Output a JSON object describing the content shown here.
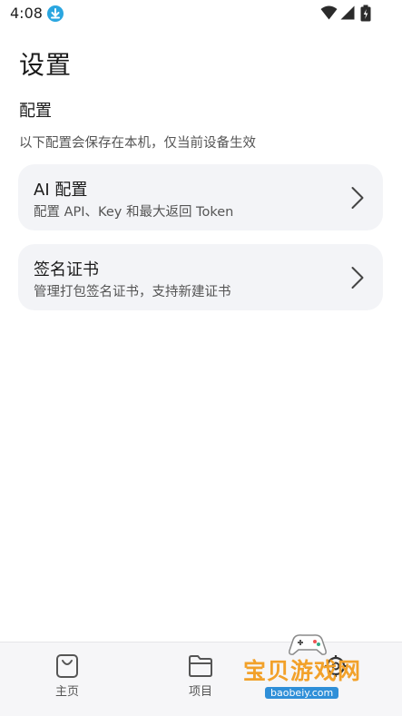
{
  "status_bar": {
    "time": "4:08"
  },
  "header": {
    "title": "设置"
  },
  "section": {
    "title": "配置",
    "description": "以下配置会保存在本机，仅当前设备生效"
  },
  "cards": [
    {
      "title": "AI 配置",
      "subtitle": "配置 API、Key 和最大返回 Token"
    },
    {
      "title": "签名证书",
      "subtitle": "管理打包签名证书，支持新建证书"
    }
  ],
  "bottom_nav": {
    "items": [
      {
        "label": "主页",
        "icon": "bag-icon"
      },
      {
        "label": "项目",
        "icon": "folder-icon"
      },
      {
        "label": "",
        "icon": "gear-icon"
      }
    ]
  },
  "watermark": {
    "text": "宝贝游戏网",
    "url": "baobeiy.com"
  },
  "colors": {
    "card_bg": "#f3f4f7",
    "accent_download": "#2aa6e0",
    "watermark_orange": "#f2a12a",
    "watermark_blue": "#2f8fd8"
  }
}
